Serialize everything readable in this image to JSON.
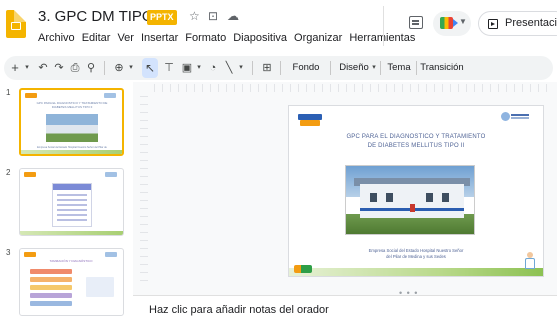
{
  "document": {
    "title": "3. GPC DM TIPO II",
    "extension_badge": "PPTX",
    "title_icons": [
      "star-icon",
      "move-to-folder-icon",
      "cloud-status-icon"
    ]
  },
  "menu": {
    "items": [
      "Archivo",
      "Editar",
      "Ver",
      "Insertar",
      "Formato",
      "Diapositiva",
      "Organizar",
      "Herramientas"
    ]
  },
  "header_actions": {
    "present_label": "Presentación"
  },
  "toolbar": {
    "background_label": "Fondo",
    "layout_label": "Diseño",
    "theme_label": "Tema",
    "transition_label": "Transición"
  },
  "filmstrip": {
    "slides": [
      {
        "number": "1",
        "title": "GPC PARA EL DIAGNOSTICO Y TRATAMIENTO DE DIABETES MELLITUS TIPO II",
        "caption": "Empresa Social del Estado Hospital Nuestro Señor del Pilar de Medina y sus Sedes"
      },
      {
        "number": "2"
      },
      {
        "number": "3",
        "title": "TAMIZACIÓN Y DIAGNÓSTICO"
      }
    ]
  },
  "slide": {
    "title_line1": "GPC PARA EL DIAGNOSTICO Y TRATAMIENTO",
    "title_line2": "DE DIABETES MELLITUS TIPO II",
    "caption_line1": "Empresa Social del Estado Hospital Nuestro Señor",
    "caption_line2": "del Pilar de Medina y sus Sedes"
  },
  "notes": {
    "placeholder": "Haz clic para añadir notas del orador"
  },
  "colors": {
    "accent_yellow": "#f4b400",
    "slide_title_blue": "#4f6395",
    "toolbar_bg": "#f1f3f4"
  }
}
